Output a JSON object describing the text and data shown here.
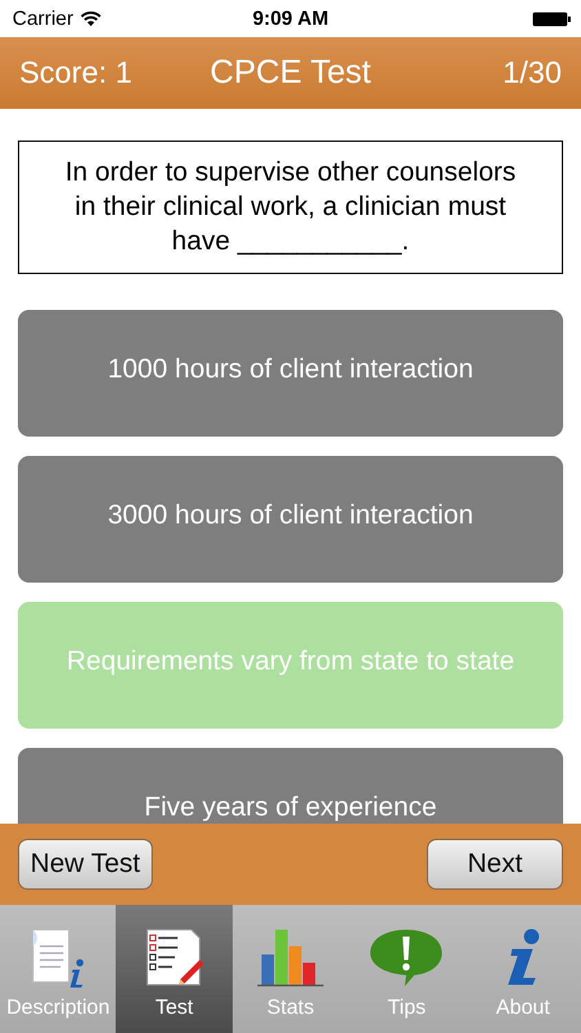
{
  "status_bar": {
    "carrier": "Carrier",
    "time": "9:09 AM"
  },
  "header": {
    "score": "Score: 1",
    "title": "CPCE Test",
    "progress": "1/30"
  },
  "question": "In order to supervise other counselors in their clinical work, a clinician must have ___________.",
  "answers": [
    {
      "text": "1000 hours of client interaction",
      "highlighted": false
    },
    {
      "text": "3000 hours of client interaction",
      "highlighted": false
    },
    {
      "text": "Requirements vary from state to state",
      "highlighted": true
    },
    {
      "text": "Five years of experience",
      "highlighted": false
    }
  ],
  "toolbar": {
    "left_button": "New Test",
    "right_button": "Next"
  },
  "tabs": [
    {
      "label": "Description",
      "kind": "description",
      "selected": false
    },
    {
      "label": "Test",
      "kind": "test",
      "selected": true
    },
    {
      "label": "Stats",
      "kind": "stats",
      "selected": false
    },
    {
      "label": "Tips",
      "kind": "tips",
      "selected": false
    },
    {
      "label": "About",
      "kind": "about",
      "selected": false
    }
  ]
}
